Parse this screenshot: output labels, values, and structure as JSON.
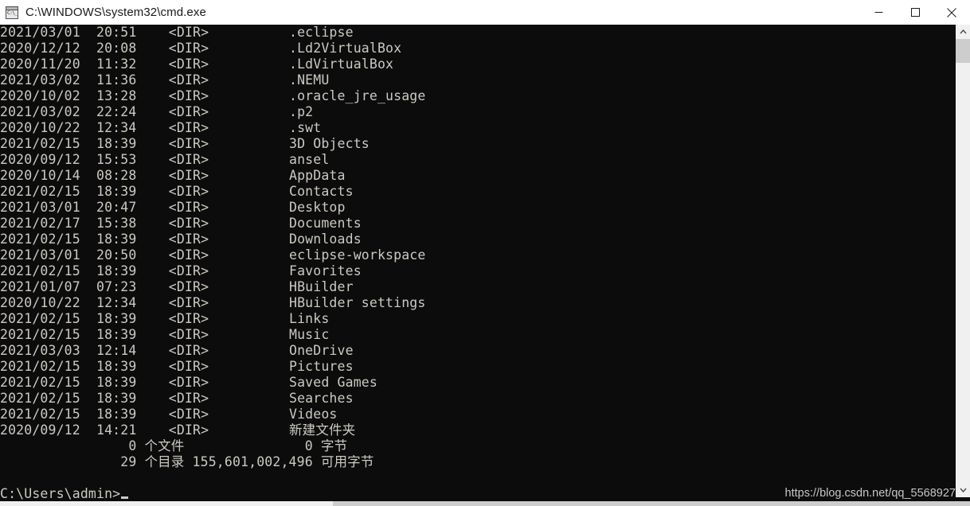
{
  "window": {
    "title": "C:\\WINDOWS\\system32\\cmd.exe",
    "icon": "cmd-console-icon",
    "background_color": "#0c0c0c",
    "text_color": "#ccc9c2",
    "titlebar_color": "#ffffff",
    "controls": {
      "minimize": "minimize",
      "maximize": "maximize",
      "close": "close"
    }
  },
  "console": {
    "columns": {
      "date": "date",
      "time": "time",
      "type": "<DIR>",
      "name": "name"
    },
    "entries": [
      {
        "date": "2021/03/01",
        "time": "20:51",
        "type": "<DIR>",
        "name": ".eclipse"
      },
      {
        "date": "2020/12/12",
        "time": "20:08",
        "type": "<DIR>",
        "name": ".Ld2VirtualBox"
      },
      {
        "date": "2020/11/20",
        "time": "11:32",
        "type": "<DIR>",
        "name": ".LdVirtualBox"
      },
      {
        "date": "2021/03/02",
        "time": "11:36",
        "type": "<DIR>",
        "name": ".NEMU"
      },
      {
        "date": "2020/10/02",
        "time": "13:28",
        "type": "<DIR>",
        "name": ".oracle_jre_usage"
      },
      {
        "date": "2021/03/02",
        "time": "22:24",
        "type": "<DIR>",
        "name": ".p2"
      },
      {
        "date": "2020/10/22",
        "time": "12:34",
        "type": "<DIR>",
        "name": ".swt"
      },
      {
        "date": "2021/02/15",
        "time": "18:39",
        "type": "<DIR>",
        "name": "3D Objects"
      },
      {
        "date": "2020/09/12",
        "time": "15:53",
        "type": "<DIR>",
        "name": "ansel"
      },
      {
        "date": "2020/10/14",
        "time": "08:28",
        "type": "<DIR>",
        "name": "AppData"
      },
      {
        "date": "2021/02/15",
        "time": "18:39",
        "type": "<DIR>",
        "name": "Contacts"
      },
      {
        "date": "2021/03/01",
        "time": "20:47",
        "type": "<DIR>",
        "name": "Desktop"
      },
      {
        "date": "2021/02/17",
        "time": "15:38",
        "type": "<DIR>",
        "name": "Documents"
      },
      {
        "date": "2021/02/15",
        "time": "18:39",
        "type": "<DIR>",
        "name": "Downloads"
      },
      {
        "date": "2021/03/01",
        "time": "20:50",
        "type": "<DIR>",
        "name": "eclipse-workspace"
      },
      {
        "date": "2021/02/15",
        "time": "18:39",
        "type": "<DIR>",
        "name": "Favorites"
      },
      {
        "date": "2021/01/07",
        "time": "07:23",
        "type": "<DIR>",
        "name": "HBuilder"
      },
      {
        "date": "2020/10/22",
        "time": "12:34",
        "type": "<DIR>",
        "name": "HBuilder settings"
      },
      {
        "date": "2021/02/15",
        "time": "18:39",
        "type": "<DIR>",
        "name": "Links"
      },
      {
        "date": "2021/02/15",
        "time": "18:39",
        "type": "<DIR>",
        "name": "Music"
      },
      {
        "date": "2021/03/03",
        "time": "12:14",
        "type": "<DIR>",
        "name": "OneDrive"
      },
      {
        "date": "2021/02/15",
        "time": "18:39",
        "type": "<DIR>",
        "name": "Pictures"
      },
      {
        "date": "2021/02/15",
        "time": "18:39",
        "type": "<DIR>",
        "name": "Saved Games"
      },
      {
        "date": "2021/02/15",
        "time": "18:39",
        "type": "<DIR>",
        "name": "Searches"
      },
      {
        "date": "2021/02/15",
        "time": "18:39",
        "type": "<DIR>",
        "name": "Videos"
      },
      {
        "date": "2020/09/12",
        "time": "14:21",
        "type": "<DIR>",
        "name": "新建文件夹"
      }
    ],
    "summary": {
      "file_count": "0",
      "file_label": "个文件",
      "file_bytes": "0",
      "bytes_label": "字节",
      "dir_count": "29",
      "dir_label": "个目录",
      "free_bytes": "155,601,002,496",
      "free_label": "可用字节"
    },
    "prompt": "C:\\Users\\admin>",
    "cursor_visible": true
  },
  "watermark": {
    "text": "https://blog.csdn.net/qq_5568927"
  },
  "scrollbars": {
    "vertical": {
      "up_arrow": "chevron-up",
      "down_arrow": "chevron-down"
    },
    "horizontal": {
      "visible": true
    }
  }
}
